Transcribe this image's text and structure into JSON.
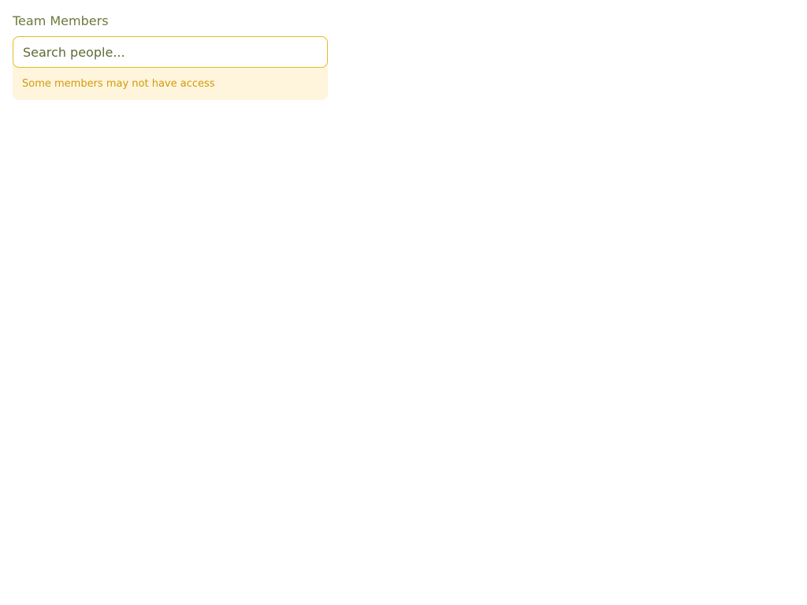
{
  "field": {
    "label": "Team Members",
    "search": {
      "placeholder": "Search people...",
      "value": ""
    },
    "warning": "Some members may not have access"
  },
  "colors": {
    "label": "#6b7a3c",
    "input_border": "#e8b820",
    "warning_background": "#fff5dd",
    "warning_text": "#d19a0a"
  }
}
